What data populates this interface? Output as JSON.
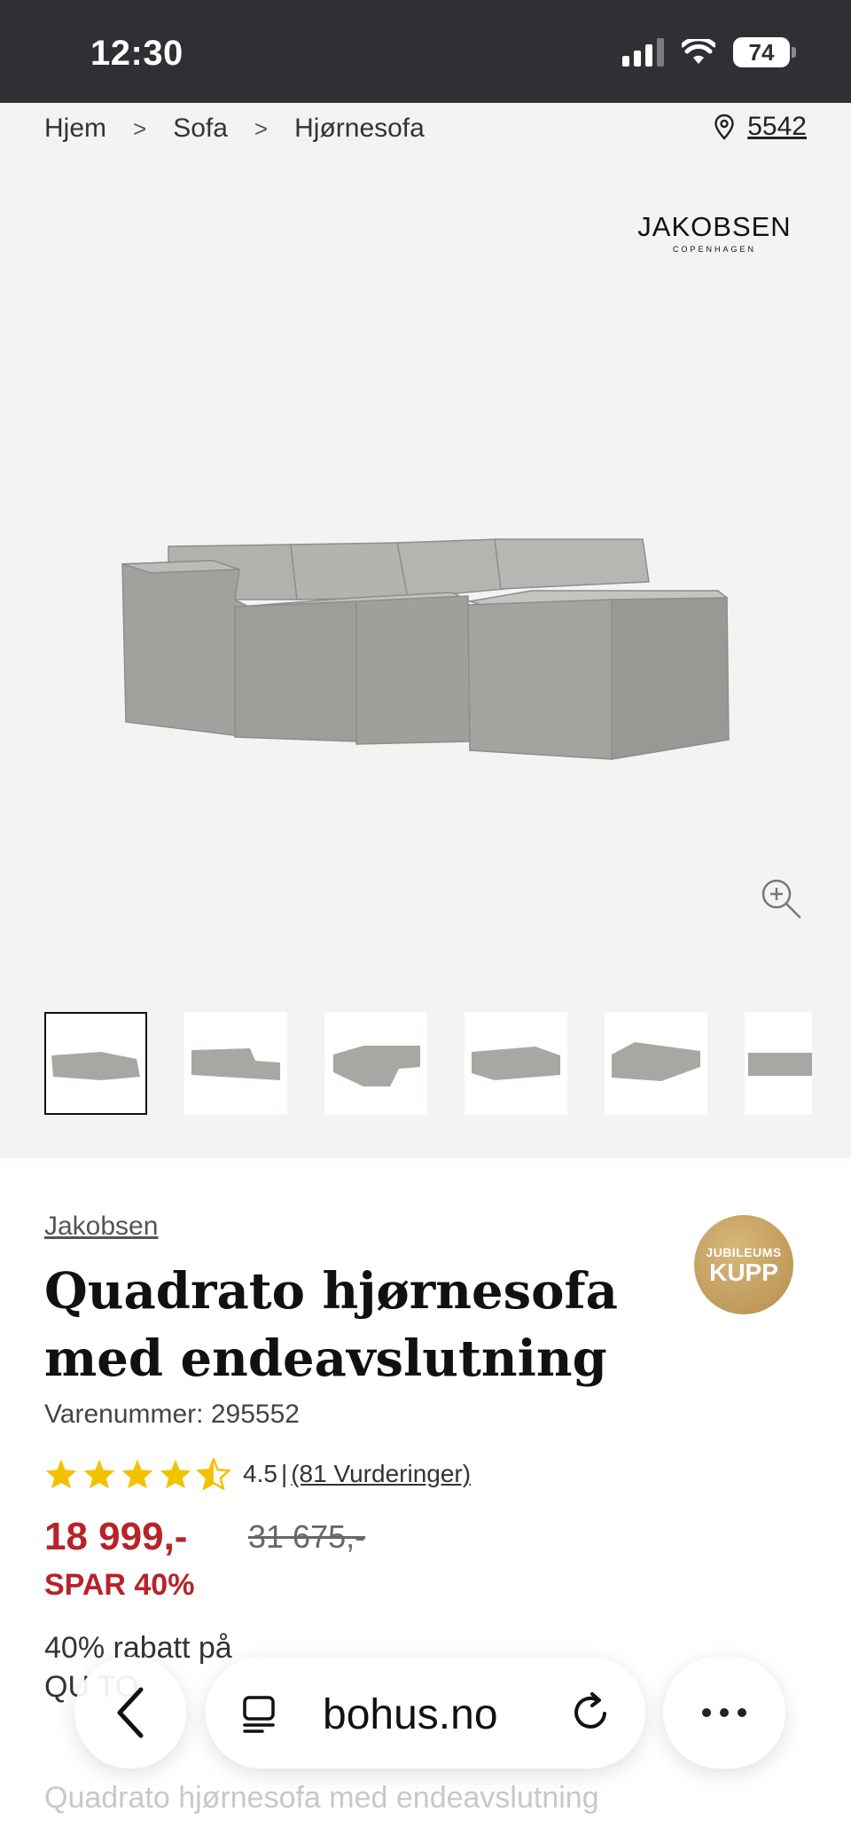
{
  "status_bar": {
    "time": "12:30",
    "battery": "74"
  },
  "breadcrumb": {
    "items": [
      "Hjem",
      "Sofa",
      "Hjørnesofa"
    ],
    "separator": ">"
  },
  "store": {
    "number": "5542",
    "icon": "location-pin-icon"
  },
  "gallery": {
    "brand_logo": {
      "line1": "JAKOBSEN",
      "line2": "COPENHAGEN"
    },
    "zoom_icon": "zoom-in-icon",
    "thumbnails_count": 6,
    "active_thumbnail": 1
  },
  "product": {
    "brand": "Jakobsen",
    "badge": {
      "line1": "JUBILEUMS",
      "line2": "KUPP",
      "color": "#c8a264"
    },
    "title": "Quadrato hjørnesofa med endeavslutning",
    "sku": "Varenummer: 295552",
    "rating": {
      "value": "4.5",
      "stars": 4.5,
      "separator": "|",
      "count": "(81 Vurderinger)",
      "star_color": "#f2c200"
    },
    "price": "18 999,-",
    "old_price": "31 675,-",
    "save": "SPAR 40%",
    "promo": "40% rabatt på",
    "promo_line2": "QU   TO",
    "description": "Quadrato hjørnesofa med endeavslutning",
    "price_color": "#b8232a"
  },
  "browser": {
    "url": "bohus.no"
  }
}
